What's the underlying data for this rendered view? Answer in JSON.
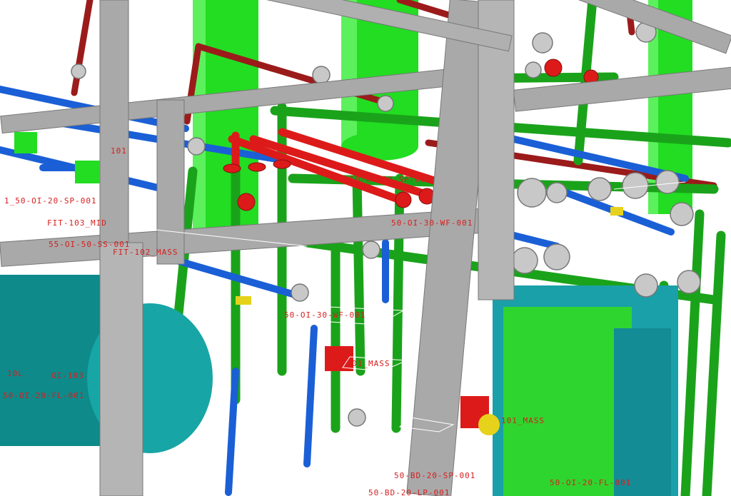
{
  "colors": {
    "background": "#ffffff",
    "steel": "#a9a9a9",
    "vessel_green": "#22dd22",
    "pipe_green": "#1aa31a",
    "pipe_blue": "#1a5fd6",
    "pipe_red": "#dd1a1a",
    "pipe_darkred": "#9b1b1b",
    "tank_teal": "#149a9a",
    "flange_gray": "#c8c8c8",
    "valve_yellow": "#e6d21a",
    "tag_red": "#d81e1e"
  },
  "tags": [
    "1_50-OI-20-SP-001",
    "FIT-103_MID",
    "55-OI-50-SS-001",
    "FIT-102_MASS",
    "50-OI-30-WF-001",
    "50-OI-20-FL-001",
    "50-BD-20-SP-001",
    "101_MASS",
    "FIT-101_MASS",
    "50-BD-20-LP-001",
    "50-OI-20-FL-001",
    "50-OI-20-SP-001",
    "10L",
    "101",
    "OI-103",
    "50-OI-30-WF-001"
  ]
}
